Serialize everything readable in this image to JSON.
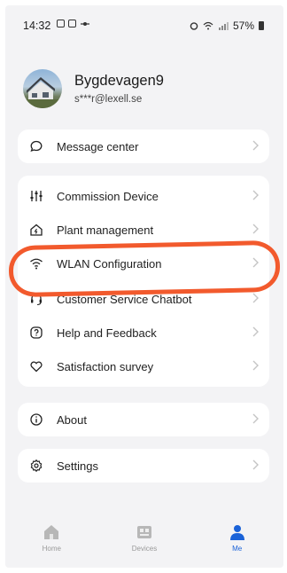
{
  "status_bar": {
    "time": "14:32",
    "battery": "57%"
  },
  "profile": {
    "name": "Bygdevagen9",
    "email": "s***r@lexell.se"
  },
  "menu": {
    "message_center": "Message center",
    "commission_device": "Commission Device",
    "plant_management": "Plant management",
    "wlan_configuration": "WLAN Configuration",
    "customer_service_chatbot": "Customer Service Chatbot",
    "help_and_feedback": "Help and Feedback",
    "satisfaction_survey": "Satisfaction survey",
    "about": "About",
    "settings": "Settings"
  },
  "bottom_nav": {
    "home": "Home",
    "devices": "Devices",
    "me": "Me"
  },
  "colors": {
    "accent": "#1a62d8",
    "annotation": "#f25a2d",
    "background": "#f3f3f5"
  }
}
